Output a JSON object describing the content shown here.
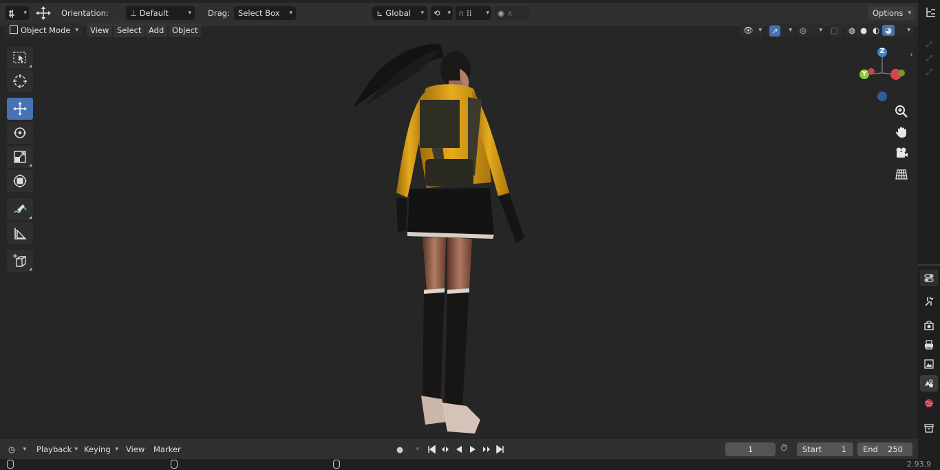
{
  "header": {
    "orientation_label": "Orientation:",
    "orientation_value": "Default",
    "drag_label": "Drag:",
    "drag_value": "Select Box",
    "transform_space": "Global",
    "options_label": "Options"
  },
  "viewport_header": {
    "mode": "Object Mode",
    "menus": [
      "View",
      "Select",
      "Add",
      "Object"
    ]
  },
  "gizmo": {
    "z_label": "Z",
    "y_label": "Y"
  },
  "timeline": {
    "editor_menus": [
      "Playback",
      "Keying",
      "View",
      "Marker"
    ],
    "current_frame": "1",
    "start_label": "Start",
    "start_value": "1",
    "end_label": "End",
    "end_value": "250"
  },
  "status": {
    "version": "2.93.9"
  },
  "colors": {
    "accent": "#4772b3",
    "axis_x": "#e0404d",
    "axis_y": "#8ccb3a",
    "axis_z": "#3d86d6",
    "jacket": "#e0a318"
  },
  "icons": {
    "toolbar": [
      "select-box-icon",
      "cursor-icon",
      "move-icon",
      "rotate-icon",
      "scale-icon",
      "transform-icon",
      "annotate-icon",
      "measure-icon",
      "add-cube-icon"
    ],
    "navigation": [
      "zoom-icon",
      "hand-icon",
      "camera-icon",
      "grid-icon"
    ],
    "properties": [
      "tool-icon",
      "render-icon",
      "output-icon",
      "view-layer-icon",
      "scene-icon",
      "world-icon",
      "collection-icon"
    ]
  }
}
